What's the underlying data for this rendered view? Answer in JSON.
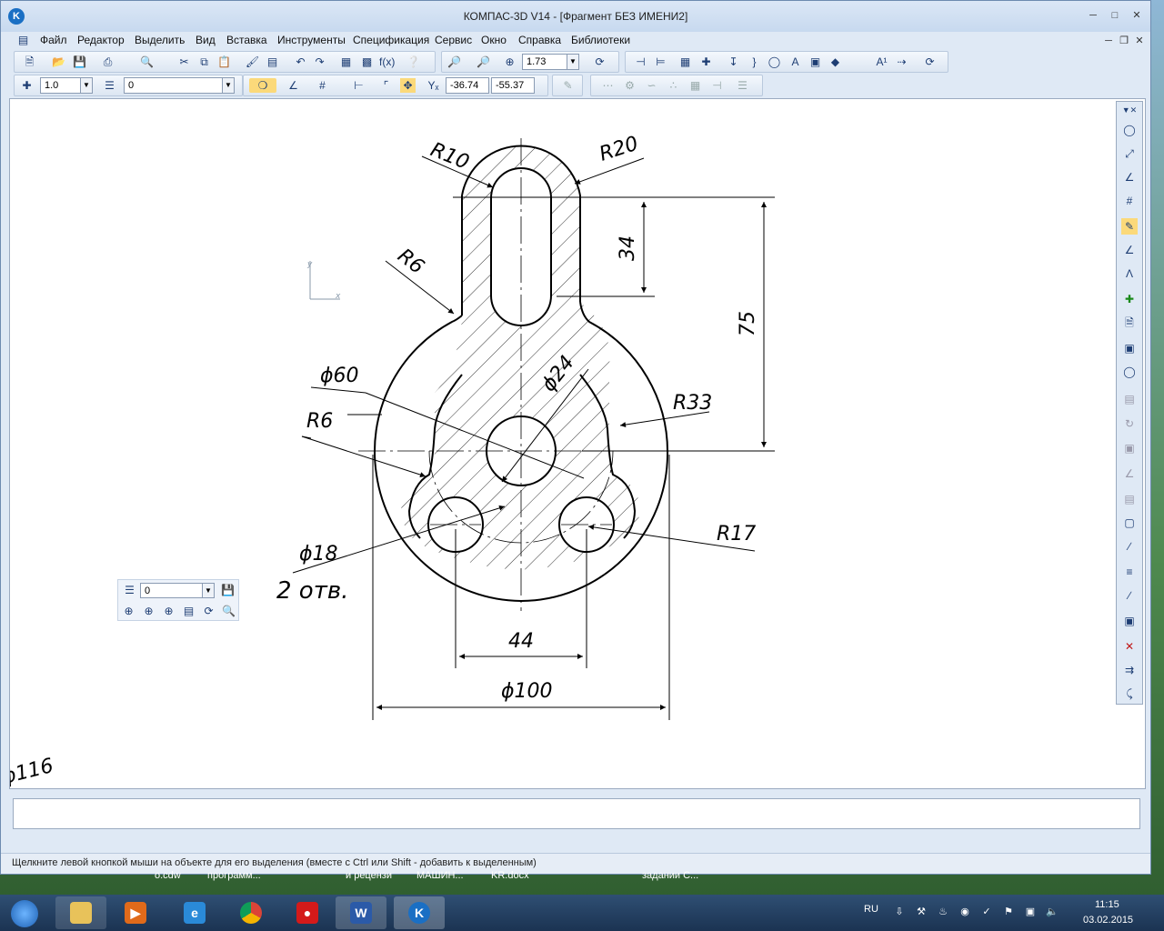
{
  "window": {
    "title": "КОМПАС-3D V14 - [Фрагмент БЕЗ ИМЕНИ2]",
    "logo": "K"
  },
  "menu": [
    "Файл",
    "Редактор",
    "Выделить",
    "Вид",
    "Вставка",
    "Инструменты",
    "Спецификация",
    "Сервис",
    "Окно",
    "Справка",
    "Библиотеки"
  ],
  "toolbar": {
    "zoom_value": "1.73",
    "line_step": "1.0",
    "layer_value": "0",
    "coord_x": "-36.74",
    "coord_y": "-55.37",
    "coord_label": "Yₓ"
  },
  "drawing": {
    "r10": "R10",
    "r20": "R20",
    "r6_top": "R6",
    "dim34": "34",
    "dim75": "75",
    "d60": "ϕ60",
    "d24": "ϕ24",
    "r33": "R33",
    "r6_left": "R6",
    "r17": "R17",
    "d18": "ϕ18",
    "holes": "2 отв.",
    "dim44": "44",
    "d100": "ϕ100",
    "d116": "ϕ116",
    "axis_x": "x",
    "axis_y": "y"
  },
  "float_panel": {
    "layer_value": "0"
  },
  "status": {
    "text": "Щелкните левой кнопкой мыши на объекте для его выделения (вместе с Ctrl или Shift - добавить к выделенным)"
  },
  "taskbar": {
    "lang": "RU",
    "time": "11:15",
    "date": "03.02.2015",
    "desktop_labels": [
      "o.cdw",
      "программ...",
      "и рецензи",
      "МАШИН...",
      "KR.docx",
      "задании С..."
    ]
  }
}
